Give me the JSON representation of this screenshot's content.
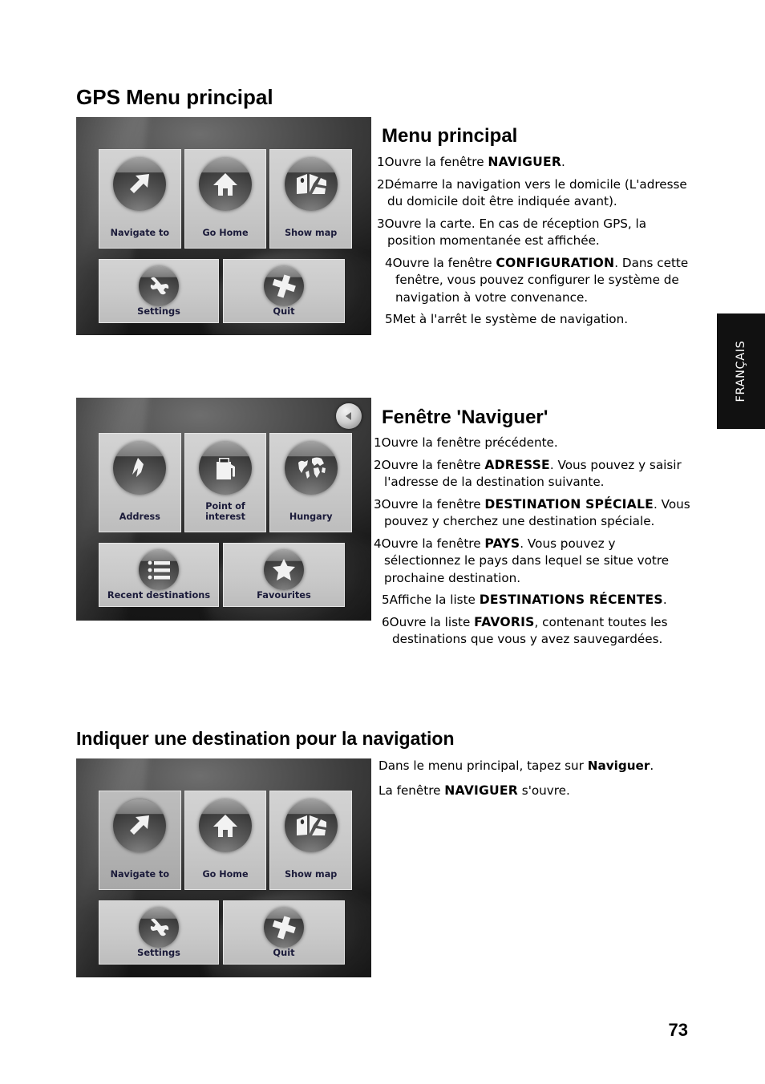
{
  "page": {
    "number": "73",
    "language_tab": "FRANÇAIS"
  },
  "sections": [
    {
      "heading": "GPS Menu principal",
      "subheading": "Menu principal",
      "items": [
        {
          "num": "1",
          "text": "Ouvre la fenêtre ",
          "emph": "NAVIGUER",
          "tail": "."
        },
        {
          "num": "2",
          "text": "Démarre la navigation vers le domicile (L'adresse du domicile doit être indiquée avant)."
        },
        {
          "num": "3",
          "text": "Ouvre la carte. En cas de réception GPS, la position momentanée est affichée."
        },
        {
          "num": "4",
          "text": "Ouvre la fenêtre ",
          "emph": "CONFIGURATION",
          "tail": ". Dans cette fenêtre, vous pouvez configurer le système de navigation à votre convenance."
        },
        {
          "num": "5",
          "text": "Met à l'arrêt le système de navigation."
        }
      ]
    },
    {
      "subheading": "Fenêtre 'Naviguer'",
      "items": [
        {
          "num": "1",
          "text": "Ouvre la fenêtre précédente."
        },
        {
          "num": "2",
          "text": "Ouvre la fenêtre ",
          "emph": "ADRESSE",
          "tail": ". Vous pouvez y saisir l'adresse de la destination suivante."
        },
        {
          "num": "3",
          "text": "Ouvre la fenêtre ",
          "emph": "DESTINATION SPÉCIALE",
          "tail": ". Vous pouvez y cherchez une destination spéciale."
        },
        {
          "num": "4",
          "text": "Ouvre la fenêtre ",
          "emph": "PAYS",
          "tail": ". Vous pouvez y sélectionnez le pays dans lequel se situe votre prochaine destination."
        },
        {
          "num": "5",
          "text": "Affiche la liste ",
          "emph": "DESTINATIONS RÉCENTES",
          "tail": "."
        },
        {
          "num": "6",
          "text": "Ouvre la liste ",
          "emph": "FAVORIS",
          "tail": ", contenant toutes les destinations que vous y avez sauvegardées."
        }
      ]
    },
    {
      "heading": "Indiquer une destination pour la navigation",
      "paragraphs": [
        {
          "lead": "Dans le menu principal, tapez sur ",
          "bold": "Naviguer",
          "tail": "."
        },
        {
          "lead": "La fenêtre ",
          "emph": "NAVIGUER",
          "tail": " s'ouvre."
        }
      ]
    }
  ],
  "device_screens": {
    "main_menu": {
      "name": "GPS main menu screen",
      "tiles_row1": [
        {
          "label": "Navigate to",
          "icon": "arrow-up-right-icon"
        },
        {
          "label": "Go Home",
          "icon": "house-icon"
        },
        {
          "label": "Show map",
          "icon": "map-icon"
        }
      ],
      "tiles_row2": [
        {
          "label": "Settings",
          "icon": "wrench-icon"
        },
        {
          "label": "Quit",
          "icon": "cross-icon"
        }
      ]
    },
    "navigate_menu": {
      "name": "GPS navigate menu screen",
      "back_button": "back-arrow-icon",
      "tiles_row1": [
        {
          "label": "Address",
          "icon": "signpost-icon"
        },
        {
          "label": "Point of\ninterest",
          "label_line1": "Point of",
          "label_line2": "interest",
          "icon": "fuel-pump-icon"
        },
        {
          "label": "Hungary",
          "icon": "globe-icon"
        }
      ],
      "tiles_row2": [
        {
          "label": "Recent destinations",
          "icon": "list-icon"
        },
        {
          "label": "Favourites",
          "icon": "star-icon"
        }
      ]
    },
    "main_menu_pressed": {
      "name": "GPS main menu screen with Navigate to pressed",
      "pressed_tile": "Navigate to",
      "tiles_row1": [
        {
          "label": "Navigate to",
          "icon": "arrow-up-right-icon"
        },
        {
          "label": "Go Home",
          "icon": "house-icon"
        },
        {
          "label": "Show map",
          "icon": "map-icon"
        }
      ],
      "tiles_row2": [
        {
          "label": "Settings",
          "icon": "wrench-icon"
        },
        {
          "label": "Quit",
          "icon": "cross-icon"
        }
      ]
    }
  },
  "colors": {
    "page_background": "#ffffff",
    "text": "#000000",
    "tab_background": "#111111",
    "tab_text": "#ffffff",
    "tile_face": "#cccccc",
    "tile_label": "#1b1b3a"
  }
}
